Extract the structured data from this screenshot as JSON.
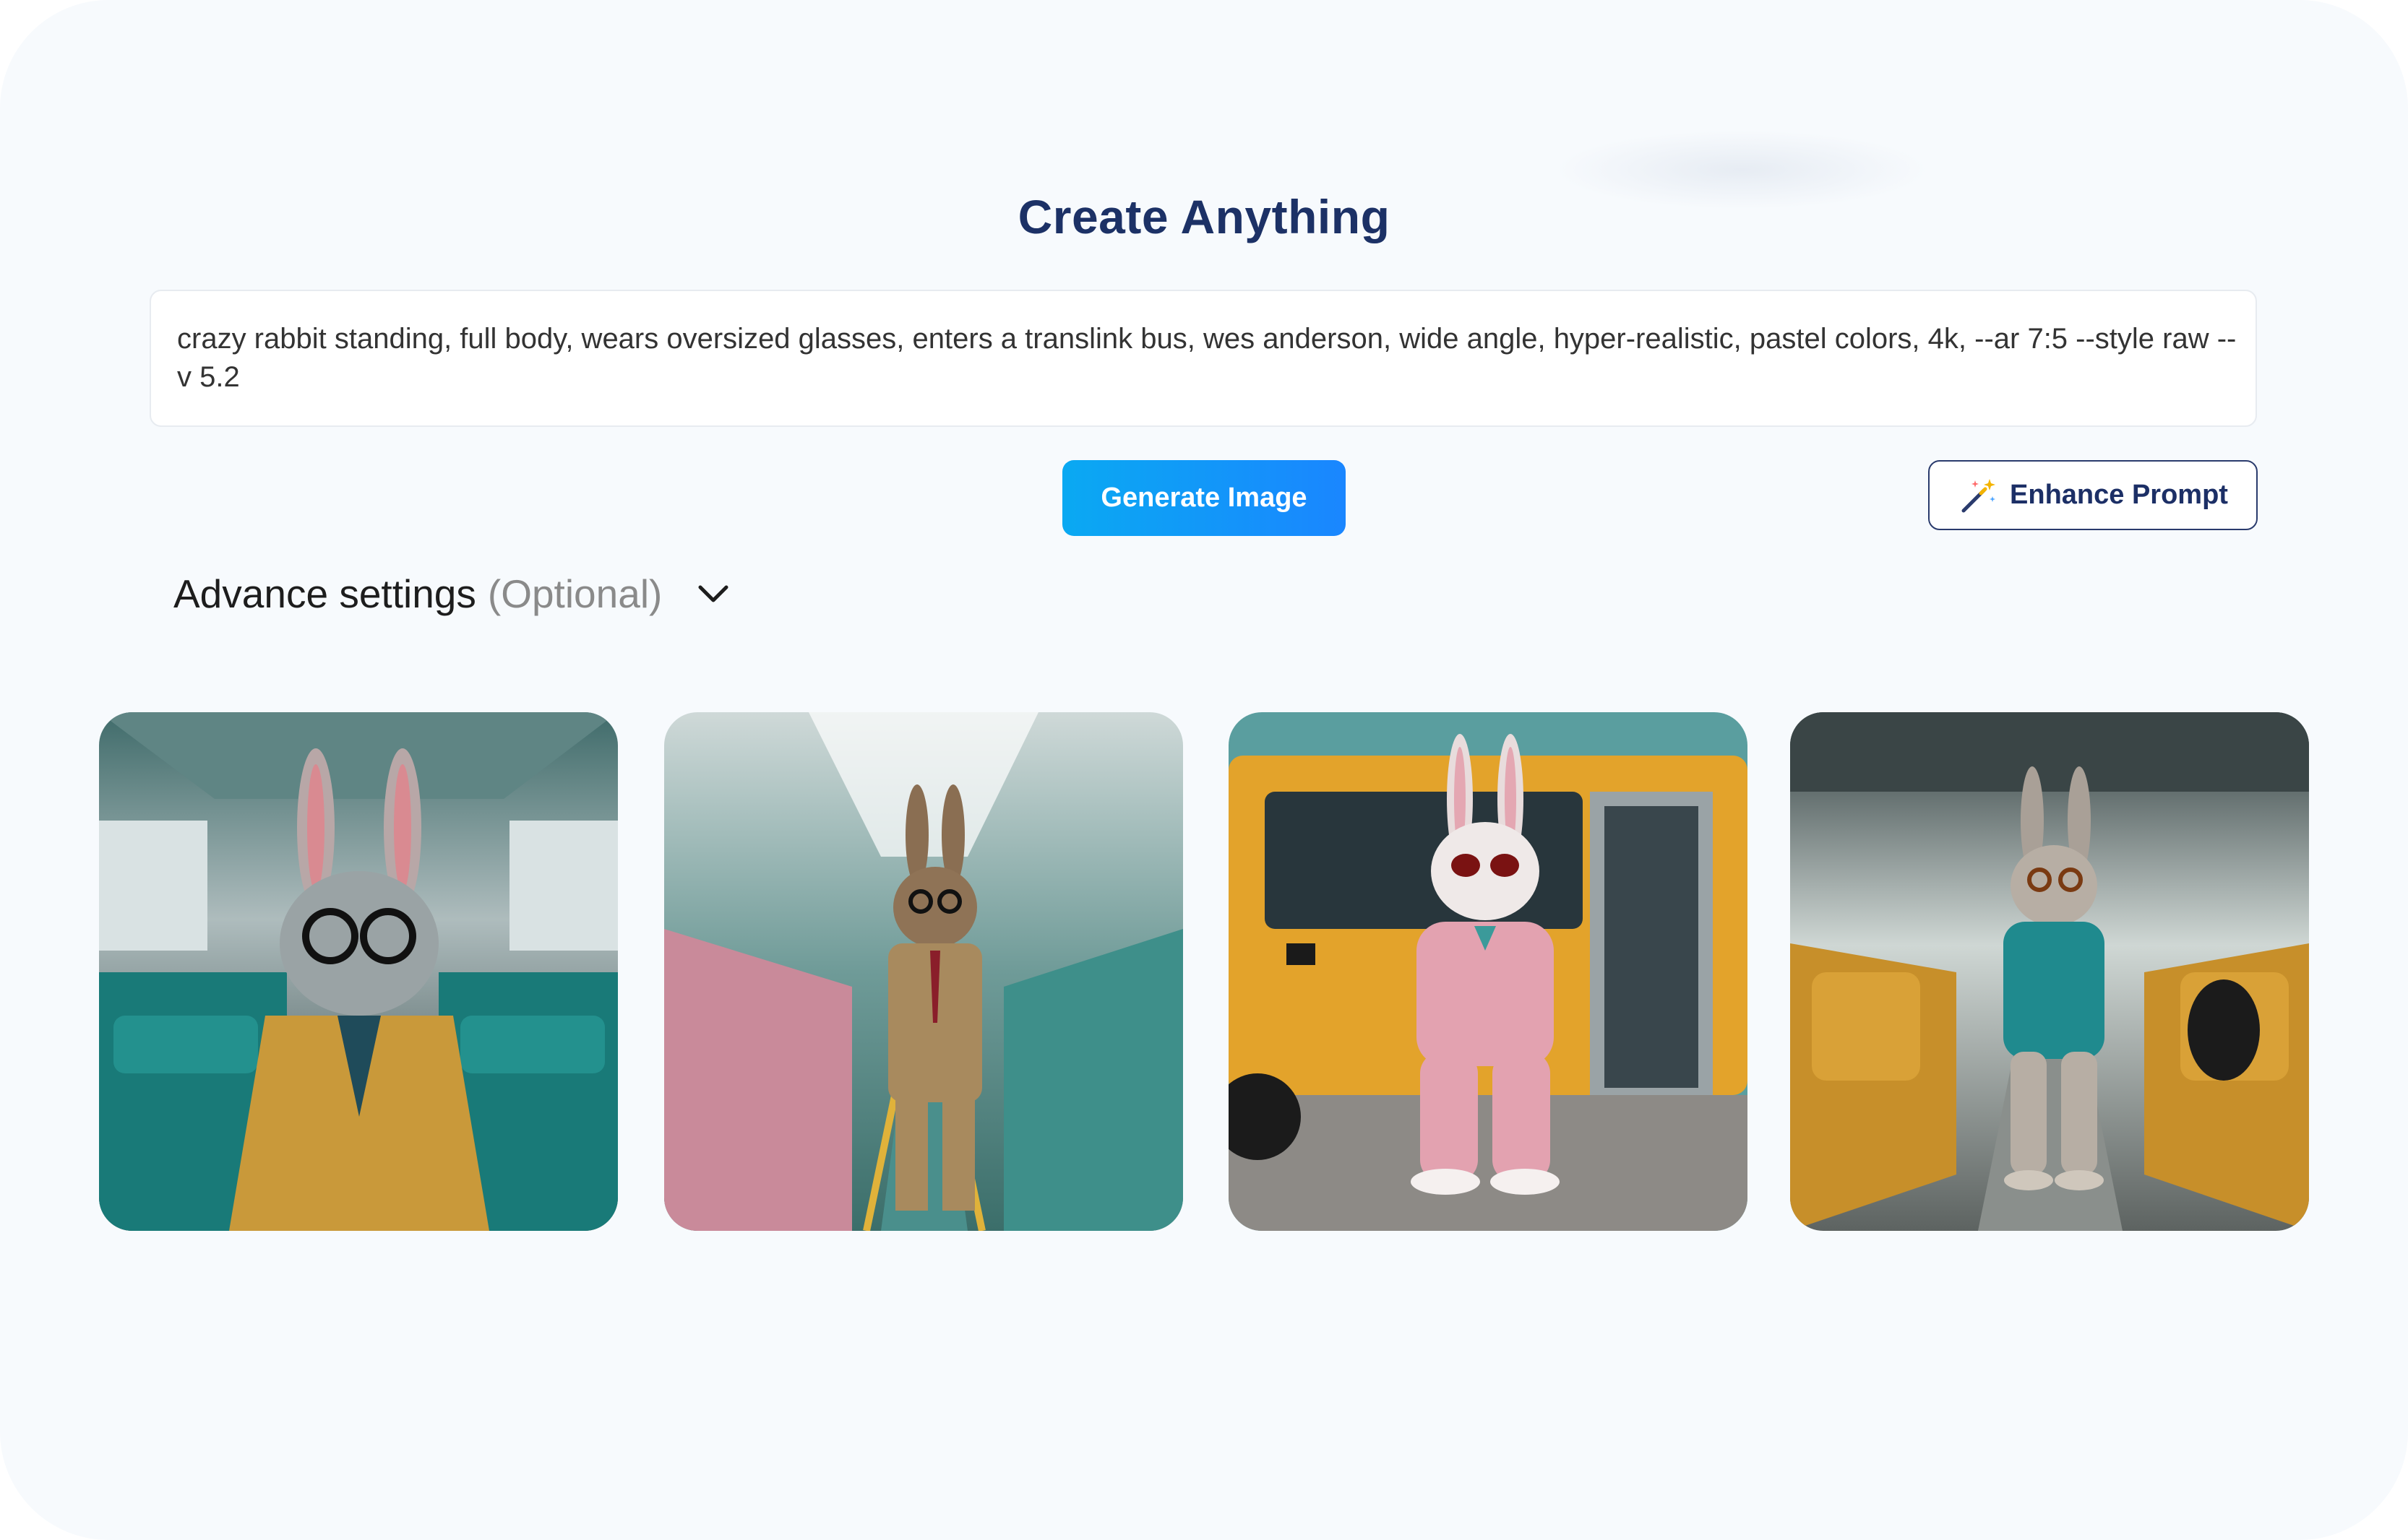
{
  "header": {
    "title": "Create Anything"
  },
  "prompt": {
    "value": "crazy rabbit standing, full body, wears oversized glasses, enters a translink bus, wes anderson, wide angle, hyper-realistic, pastel colors, 4k, --ar 7:5 --style raw --v 5.2"
  },
  "actions": {
    "generate_label": "Generate Image",
    "enhance_label": "Enhance Prompt",
    "enhance_icon": "magic-wand-icon"
  },
  "advanced": {
    "label": "Advance settings",
    "optional": "(Optional)",
    "toggle_icon": "chevron-down-icon"
  },
  "gallery": {
    "images": [
      {
        "description": "rabbit in mustard suit and glasses inside teal bus"
      },
      {
        "description": "rabbit in tan suit standing in bus aisle with pink seats"
      },
      {
        "description": "rabbit in pink suit in front of yellow bus door"
      },
      {
        "description": "rabbit in teal jacket in bus aisle with mustard seats"
      }
    ]
  },
  "colors": {
    "title": "#1c3166",
    "generate_start": "#0aa9f2",
    "generate_end": "#1a86ff",
    "enhance_border": "#2a3b6d"
  }
}
